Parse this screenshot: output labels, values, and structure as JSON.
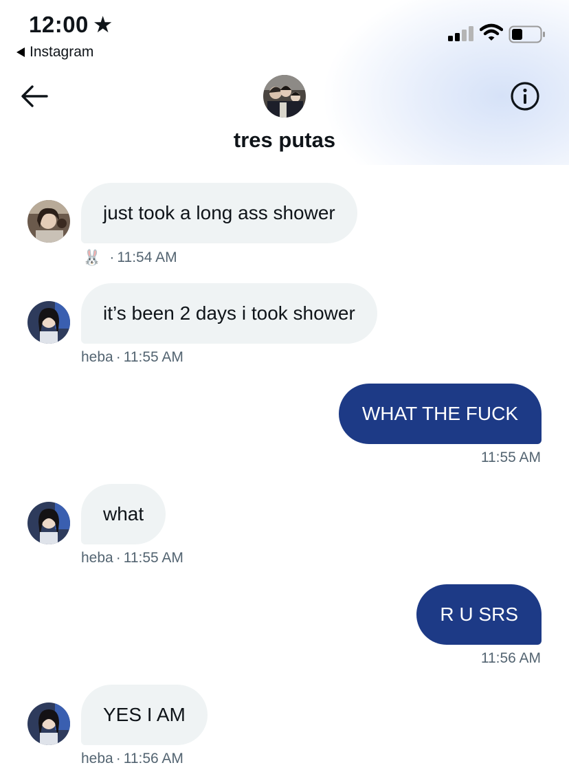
{
  "status_bar": {
    "time": "12:00",
    "star": "★",
    "back_app": "Instagram",
    "signal_icon": "cellular-signal-icon",
    "wifi_icon": "wifi-icon",
    "battery_icon": "battery-icon"
  },
  "header": {
    "back_icon": "back-arrow-icon",
    "info_icon": "info-icon",
    "group_name": "tres putas"
  },
  "messages": [
    {
      "side": "in",
      "text": "just took a long ass shower",
      "sender": "🐰",
      "sep": "·",
      "time": "11:54 AM"
    },
    {
      "side": "in",
      "text": "it’s been 2 days i took shower",
      "sender": "heba",
      "sep": "·",
      "time": "11:55 AM"
    },
    {
      "side": "out",
      "text": "WHAT THE FUCK",
      "time": "11:55 AM"
    },
    {
      "side": "in",
      "text": "what",
      "sender": "heba",
      "sep": "·",
      "time": "11:55 AM"
    },
    {
      "side": "out",
      "text": "R U SRS",
      "time": "11:56 AM"
    },
    {
      "side": "in",
      "text": "YES I AM",
      "sender": "heba",
      "sep": "·",
      "time": "11:56 AM"
    }
  ],
  "colors": {
    "incoming_bubble": "#eff3f4",
    "outgoing_bubble": "#1d3a86",
    "meta_text": "#536471"
  }
}
